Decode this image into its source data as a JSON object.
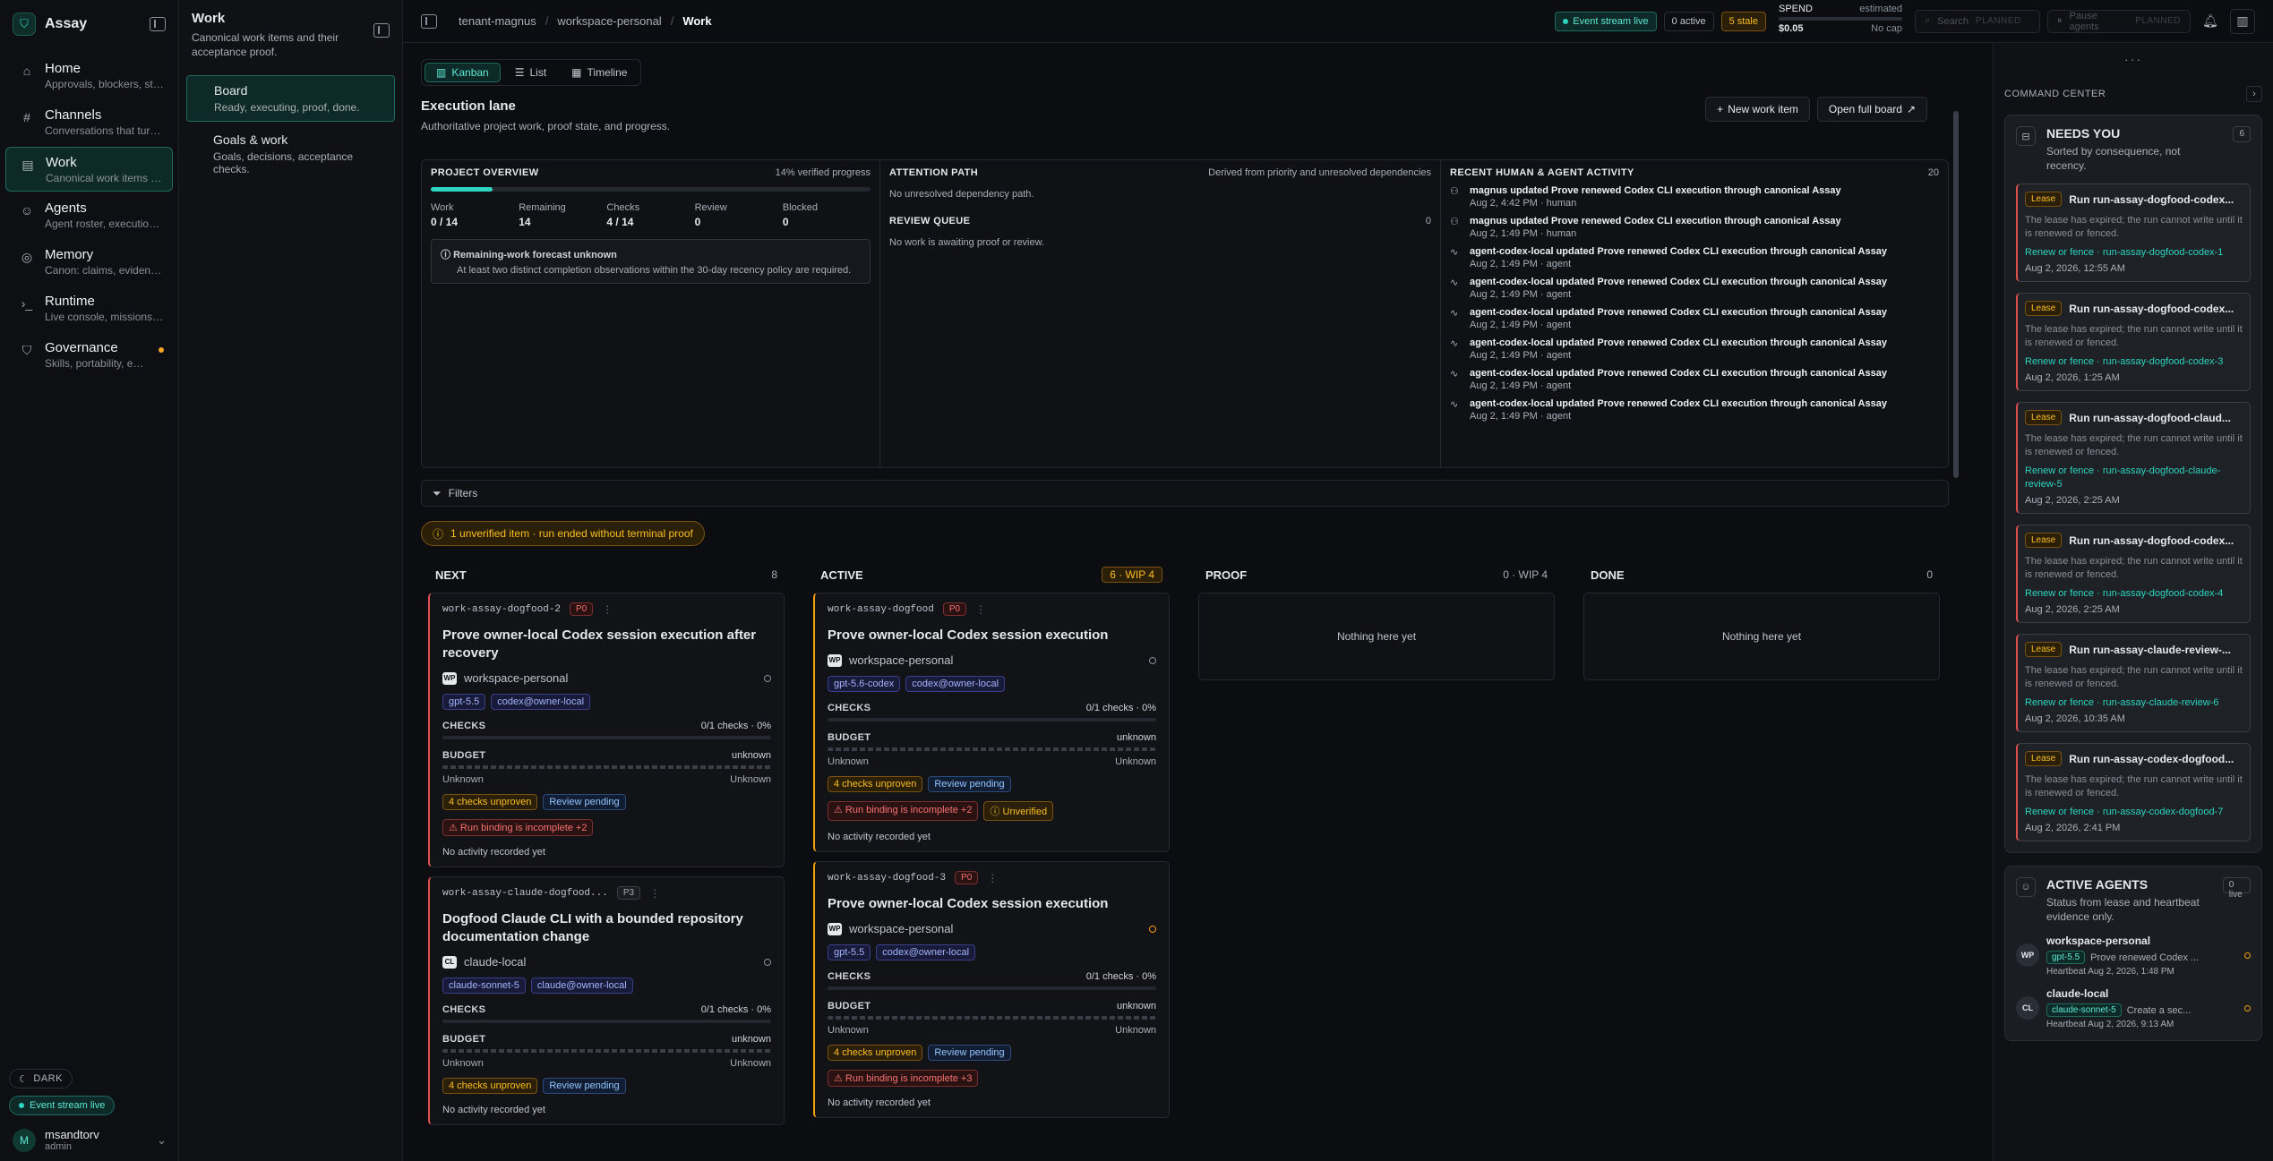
{
  "nav": {
    "brand": "Assay",
    "items": [
      {
        "title": "Home",
        "sub": "Approvals, blockers, stal..."
      },
      {
        "title": "Channels",
        "sub": "Conversations that turn t..."
      },
      {
        "title": "Work",
        "sub": "Canonical work items an..."
      },
      {
        "title": "Agents",
        "sub": "Agent roster, execution ..."
      },
      {
        "title": "Memory",
        "sub": "Canon: claims, evidence, ..."
      },
      {
        "title": "Runtime",
        "sub": "Live console, missions, a..."
      },
      {
        "title": "Governance",
        "sub": "Skills, portability, event l..."
      }
    ],
    "theme": "DARK",
    "event_stream": "Event stream live",
    "user": {
      "initial": "M",
      "name": "msandtorv",
      "role": "admin"
    }
  },
  "subnav": {
    "title": "Work",
    "desc": "Canonical work items and their acceptance proof.",
    "items": [
      {
        "title": "Board",
        "desc": "Ready, executing, proof, done."
      },
      {
        "title": "Goals & work",
        "desc": "Goals, decisions, acceptance checks."
      }
    ]
  },
  "topbar": {
    "crumbs": [
      "tenant-magnus",
      "workspace-personal",
      "Work"
    ],
    "event_stream": "Event stream live",
    "active": "0 active",
    "stale": "5 stale",
    "spend_label": "SPEND",
    "spend_est": "estimated",
    "spend_value": "$0.05",
    "spend_cap": "No cap",
    "search": "Search",
    "search_tag": "PLANNED",
    "pause": "Pause agents",
    "pause_tag": "PLANNED"
  },
  "main": {
    "tabs": [
      "Kanban",
      "List",
      "Timeline"
    ],
    "title": "Execution lane",
    "desc": "Authoritative project work, proof state, and progress.",
    "new_item": "New work item",
    "open_board": "Open full board",
    "overview": {
      "title": "PROJECT OVERVIEW",
      "progress_label": "14% verified progress",
      "progress": 0.14,
      "stats": [
        {
          "label": "Work",
          "value": "0 / 14"
        },
        {
          "label": "Remaining",
          "value": "14"
        },
        {
          "label": "Checks",
          "value": "4 / 14"
        },
        {
          "label": "Review",
          "value": "0"
        },
        {
          "label": "Blocked",
          "value": "0"
        }
      ],
      "forecast_title": "Remaining-work forecast unknown",
      "forecast_desc": "At least two distinct completion observations within the 30-day recency policy are required."
    },
    "attention": {
      "title": "ATTENTION PATH",
      "right": "Derived from priority and unresolved dependencies",
      "text": "No unresolved dependency path.",
      "review_title": "REVIEW QUEUE",
      "review_count": "0",
      "review_text": "No work is awaiting proof or review."
    },
    "activity": {
      "title": "RECENT HUMAN & AGENT ACTIVITY",
      "count": "20",
      "items": [
        {
          "icon": "person",
          "title": "magnus updated Prove renewed Codex CLI execution through canonical Assay",
          "meta": "Aug 2, 4:42 PM · human"
        },
        {
          "icon": "person",
          "title": "magnus updated Prove renewed Codex CLI execution through canonical Assay",
          "meta": "Aug 2, 1:49 PM · human"
        },
        {
          "icon": "pulse",
          "title": "agent-codex-local updated Prove renewed Codex CLI execution through canonical Assay",
          "meta": "Aug 2, 1:49 PM · agent"
        },
        {
          "icon": "pulse",
          "title": "agent-codex-local updated Prove renewed Codex CLI execution through canonical Assay",
          "meta": "Aug 2, 1:49 PM · agent"
        },
        {
          "icon": "pulse",
          "title": "agent-codex-local updated Prove renewed Codex CLI execution through canonical Assay",
          "meta": "Aug 2, 1:49 PM · agent"
        },
        {
          "icon": "pulse",
          "title": "agent-codex-local updated Prove renewed Codex CLI execution through canonical Assay",
          "meta": "Aug 2, 1:49 PM · agent"
        },
        {
          "icon": "pulse",
          "title": "agent-codex-local updated Prove renewed Codex CLI execution through canonical Assay",
          "meta": "Aug 2, 1:49 PM · agent"
        },
        {
          "icon": "pulse",
          "title": "agent-codex-local updated Prove renewed Codex CLI execution through canonical Assay",
          "meta": "Aug 2, 1:49 PM · agent"
        }
      ]
    },
    "filters": "Filters",
    "warning": "1 unverified item · run ended without terminal proof"
  },
  "board": {
    "columns": [
      {
        "title": "NEXT",
        "count": "8"
      },
      {
        "title": "ACTIVE",
        "count": "6 · WIP 4"
      },
      {
        "title": "PROOF",
        "count": "0 · WIP 4",
        "empty": "Nothing here yet"
      },
      {
        "title": "DONE",
        "count": "0",
        "empty": "Nothing here yet"
      }
    ],
    "labels": {
      "checks": "CHECKS",
      "budget": "BUDGET",
      "unknown": "unknown",
      "Unknown": "Unknown",
      "no_activity": "No activity recorded yet"
    },
    "cards": [
      {
        "id": "work-assay-dogfood-2",
        "prio": "P0",
        "title": "Prove owner-local Codex session execution after recovery",
        "ws": "workspace-personal",
        "ws_badge": "WP",
        "chips": [
          "gpt-5.5",
          "codex@owner-local"
        ],
        "checks": "0/1 checks · 0%",
        "tags": [
          "4 checks unproven",
          "Review pending"
        ],
        "alerts": [
          "Run binding is incomplete +2"
        ]
      },
      {
        "id": "work-assay-claude-dogfood...",
        "prio": "P3",
        "title": "Dogfood Claude CLI with a bounded repository documentation change",
        "ws": "claude-local",
        "ws_badge": "CL",
        "chips": [
          "claude-sonnet-5",
          "claude@owner-local"
        ],
        "checks": "0/1 checks · 0%",
        "tags": [
          "4 checks unproven",
          "Review pending"
        ]
      },
      {
        "id": "work-assay-dogfood",
        "prio": "P0",
        "title": "Prove owner-local Codex session execution",
        "ws": "workspace-personal",
        "ws_badge": "WP",
        "chips": [
          "gpt-5.6-codex",
          "codex@owner-local"
        ],
        "checks": "0/1 checks · 0%",
        "tags": [
          "4 checks unproven",
          "Review pending"
        ],
        "alerts": [
          "Run binding is incomplete +2"
        ],
        "unverified": "Unverified"
      },
      {
        "id": "work-assay-dogfood-3",
        "prio": "P0",
        "title": "Prove owner-local Codex session execution",
        "ws": "workspace-personal",
        "ws_badge": "WP",
        "chips": [
          "gpt-5.5",
          "codex@owner-local"
        ],
        "checks": "0/1 checks · 0%",
        "tags": [
          "4 checks unproven",
          "Review pending"
        ],
        "alerts": [
          "Run binding is incomplete +3"
        ]
      }
    ]
  },
  "right": {
    "title": "COMMAND CENTER",
    "needs": {
      "title": "NEEDS YOU",
      "desc": "Sorted by consequence, not recency.",
      "count": "6"
    },
    "lease_tag": "Lease",
    "lease_desc": "The lease has expired; the run cannot write until it is renewed or fenced.",
    "leases": [
      {
        "title": "Run run-assay-dogfood-codex...",
        "link": "Renew or fence · run-assay-dogfood-codex-1",
        "time": "Aug 2, 2026, 12:55 AM"
      },
      {
        "title": "Run run-assay-dogfood-codex...",
        "link": "Renew or fence · run-assay-dogfood-codex-3",
        "time": "Aug 2, 2026, 1:25 AM"
      },
      {
        "title": "Run run-assay-dogfood-claud...",
        "link": "Renew or fence · run-assay-dogfood-claude-review-5",
        "time": "Aug 2, 2026, 2:25 AM"
      },
      {
        "title": "Run run-assay-dogfood-codex...",
        "link": "Renew or fence · run-assay-dogfood-codex-4",
        "time": "Aug 2, 2026, 2:25 AM"
      },
      {
        "title": "Run run-assay-claude-review-...",
        "link": "Renew or fence · run-assay-claude-review-6",
        "time": "Aug 2, 2026, 10:35 AM"
      },
      {
        "title": "Run run-assay-codex-dogfood...",
        "link": "Renew or fence · run-assay-codex-dogfood-7",
        "time": "Aug 2, 2026, 2:41 PM"
      }
    ],
    "agents": {
      "title": "ACTIVE AGENTS",
      "count": "0 live",
      "desc": "Status from lease and heartbeat evidence only.",
      "items": [
        {
          "badge": "WP",
          "name": "workspace-personal",
          "chip": "gpt-5.5",
          "task": "Prove renewed Codex ...",
          "hb": "Heartbeat Aug 2, 2026, 1:48 PM"
        },
        {
          "badge": "CL",
          "name": "claude-local",
          "chip": "claude-sonnet-5",
          "task": "Create a sec...",
          "hb": "Heartbeat Aug 2, 2026, 9:13 AM"
        }
      ]
    }
  }
}
